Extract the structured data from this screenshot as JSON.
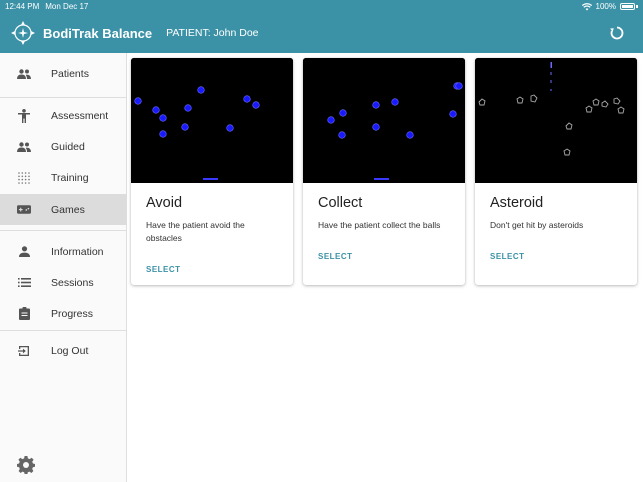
{
  "status_bar": {
    "time": "12:44 PM",
    "date": "Mon Dec 17",
    "battery": "100%"
  },
  "header": {
    "app_title": "BodiTrak Balance",
    "patient_label": "PATIENT: John Doe"
  },
  "sidebar": {
    "items": [
      {
        "label": "Patients",
        "icon": "people-icon"
      },
      {
        "label": "Assessment",
        "icon": "person-icon"
      },
      {
        "label": "Guided",
        "icon": "people-icon"
      },
      {
        "label": "Training",
        "icon": "dots-grid-icon"
      },
      {
        "label": "Games",
        "icon": "gamepad-icon"
      },
      {
        "label": "Information",
        "icon": "person-icon"
      },
      {
        "label": "Sessions",
        "icon": "list-icon"
      },
      {
        "label": "Progress",
        "icon": "clipboard-icon"
      },
      {
        "label": "Log Out",
        "icon": "exit-icon"
      }
    ],
    "active": "Games"
  },
  "games": [
    {
      "title": "Avoid",
      "description": "Have the patient avoid the obstacles",
      "action": "SELECT"
    },
    {
      "title": "Collect",
      "description": "Have the patient collect the balls",
      "action": "SELECT"
    },
    {
      "title": "Asteroid",
      "description": "Don't get hit by asteroids",
      "action": "SELECT"
    }
  ],
  "colors": {
    "brand": "#3b92a7",
    "active_nav": "#dcdcdc",
    "ball": "#1a1aff"
  }
}
